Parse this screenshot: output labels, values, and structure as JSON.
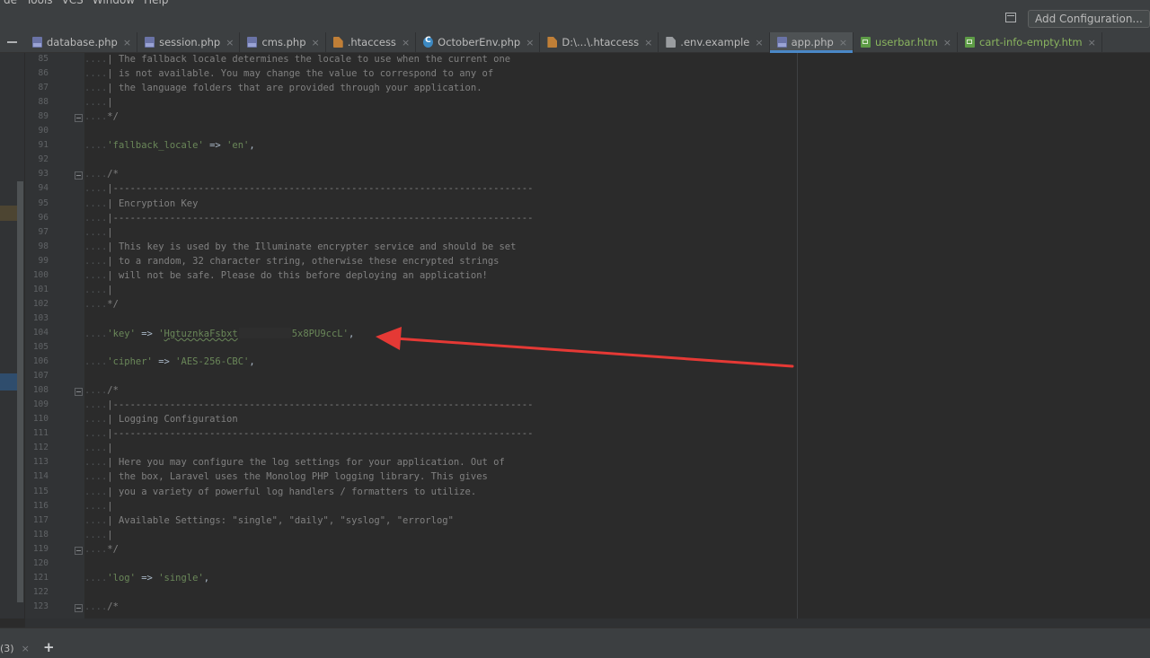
{
  "menu": {
    "items": [
      "de",
      "Tools",
      "VCS",
      "Window",
      "Help"
    ]
  },
  "toolbar": {
    "add_configuration_label": "Add Configuration..."
  },
  "tabs": [
    {
      "label": "database.php",
      "icon": "php-file-icon",
      "close": "×"
    },
    {
      "label": "session.php",
      "icon": "php-file-icon",
      "close": "×"
    },
    {
      "label": "cms.php",
      "icon": "php-file-icon",
      "close": "×"
    },
    {
      "label": ".htaccess",
      "icon": "htaccess-file-icon",
      "close": "×"
    },
    {
      "label": "OctoberEnv.php",
      "icon": "php-class-icon",
      "close": "×"
    },
    {
      "label": "D:\\...\\.htaccess",
      "icon": "htaccess-file-icon",
      "close": "×"
    },
    {
      "label": ".env.example",
      "icon": "text-file-icon",
      "close": "×"
    },
    {
      "label": "app.php",
      "icon": "php-file-icon",
      "close": "×",
      "active": true
    },
    {
      "label": "userbar.htm",
      "icon": "htm-file-icon",
      "close": "×"
    },
    {
      "label": "cart-info-empty.htm",
      "icon": "htm-file-icon",
      "close": "×"
    }
  ],
  "editor": {
    "lines": [
      {
        "no": "85",
        "ws": "....",
        "text": "| The fallback locale determines the locale to use when the current one"
      },
      {
        "no": "86",
        "ws": "....",
        "text": "| is not available. You may change the value to correspond to any of"
      },
      {
        "no": "87",
        "ws": "....",
        "text": "| the language folders that are provided through your application."
      },
      {
        "no": "88",
        "ws": "....",
        "text": "|"
      },
      {
        "no": "89",
        "ws": "....",
        "text": "*/"
      },
      {
        "no": "90",
        "ws": "",
        "text": ""
      },
      {
        "no": "91",
        "ws": "....",
        "text": "",
        "kv": {
          "key": "'fallback_locale'",
          "op": " => ",
          "val": "'en'",
          "tail": ","
        }
      },
      {
        "no": "92",
        "ws": "",
        "text": ""
      },
      {
        "no": "93",
        "ws": "....",
        "text": "/*"
      },
      {
        "no": "94",
        "ws": "....",
        "text": "|--------------------------------------------------------------------------"
      },
      {
        "no": "95",
        "ws": "....",
        "text": "| Encryption Key"
      },
      {
        "no": "96",
        "ws": "....",
        "text": "|--------------------------------------------------------------------------"
      },
      {
        "no": "97",
        "ws": "....",
        "text": "|"
      },
      {
        "no": "98",
        "ws": "....",
        "text": "| This key is used by the Illuminate encrypter service and should be set"
      },
      {
        "no": "99",
        "ws": "....",
        "text": "| to a random, 32 character string, otherwise these encrypted strings"
      },
      {
        "no": "100",
        "ws": "....",
        "text": "| will not be safe. Please do this before deploying an application!"
      },
      {
        "no": "101",
        "ws": "....",
        "text": "|"
      },
      {
        "no": "102",
        "ws": "....",
        "text": "*/"
      },
      {
        "no": "103",
        "ws": "",
        "text": ""
      },
      {
        "no": "104",
        "ws": "....",
        "text": "",
        "kv": {
          "key": "'key'",
          "op": " => ",
          "val": "'",
          "val_a": "HgtuznkaFsbxt",
          "val_b": "5x8PU9ccL'",
          "tail": ",",
          "redacted": true
        }
      },
      {
        "no": "105",
        "ws": "",
        "text": ""
      },
      {
        "no": "106",
        "ws": "....",
        "text": "",
        "kv": {
          "key": "'cipher'",
          "op": " => ",
          "val": "'AES-256-CBC'",
          "tail": ","
        }
      },
      {
        "no": "107",
        "ws": "",
        "text": ""
      },
      {
        "no": "108",
        "ws": "....",
        "text": "/*"
      },
      {
        "no": "109",
        "ws": "....",
        "text": "|--------------------------------------------------------------------------"
      },
      {
        "no": "110",
        "ws": "....",
        "text": "| Logging Configuration"
      },
      {
        "no": "111",
        "ws": "....",
        "text": "|--------------------------------------------------------------------------"
      },
      {
        "no": "112",
        "ws": "....",
        "text": "|"
      },
      {
        "no": "113",
        "ws": "....",
        "text": "| Here you may configure the log settings for your application. Out of"
      },
      {
        "no": "114",
        "ws": "....",
        "text": "| the box, Laravel uses the Monolog PHP logging library. This gives"
      },
      {
        "no": "115",
        "ws": "....",
        "text": "| you a variety of powerful log handlers / formatters to utilize."
      },
      {
        "no": "116",
        "ws": "....",
        "text": "|"
      },
      {
        "no": "117",
        "ws": "....",
        "text": "| Available Settings: \"single\", \"daily\", \"syslog\", \"errorlog\""
      },
      {
        "no": "118",
        "ws": "....",
        "text": "|"
      },
      {
        "no": "119",
        "ws": "....",
        "text": "*/"
      },
      {
        "no": "120",
        "ws": "",
        "text": ""
      },
      {
        "no": "121",
        "ws": "....",
        "text": "",
        "kv": {
          "key": "'log'",
          "op": " => ",
          "val": "'single'",
          "tail": ","
        }
      },
      {
        "no": "122",
        "ws": "",
        "text": ""
      },
      {
        "no": "123",
        "ws": "....",
        "text": "/*"
      }
    ]
  },
  "bottom": {
    "tab_label": "(3)",
    "tab_close": "×",
    "add_label": "+"
  }
}
